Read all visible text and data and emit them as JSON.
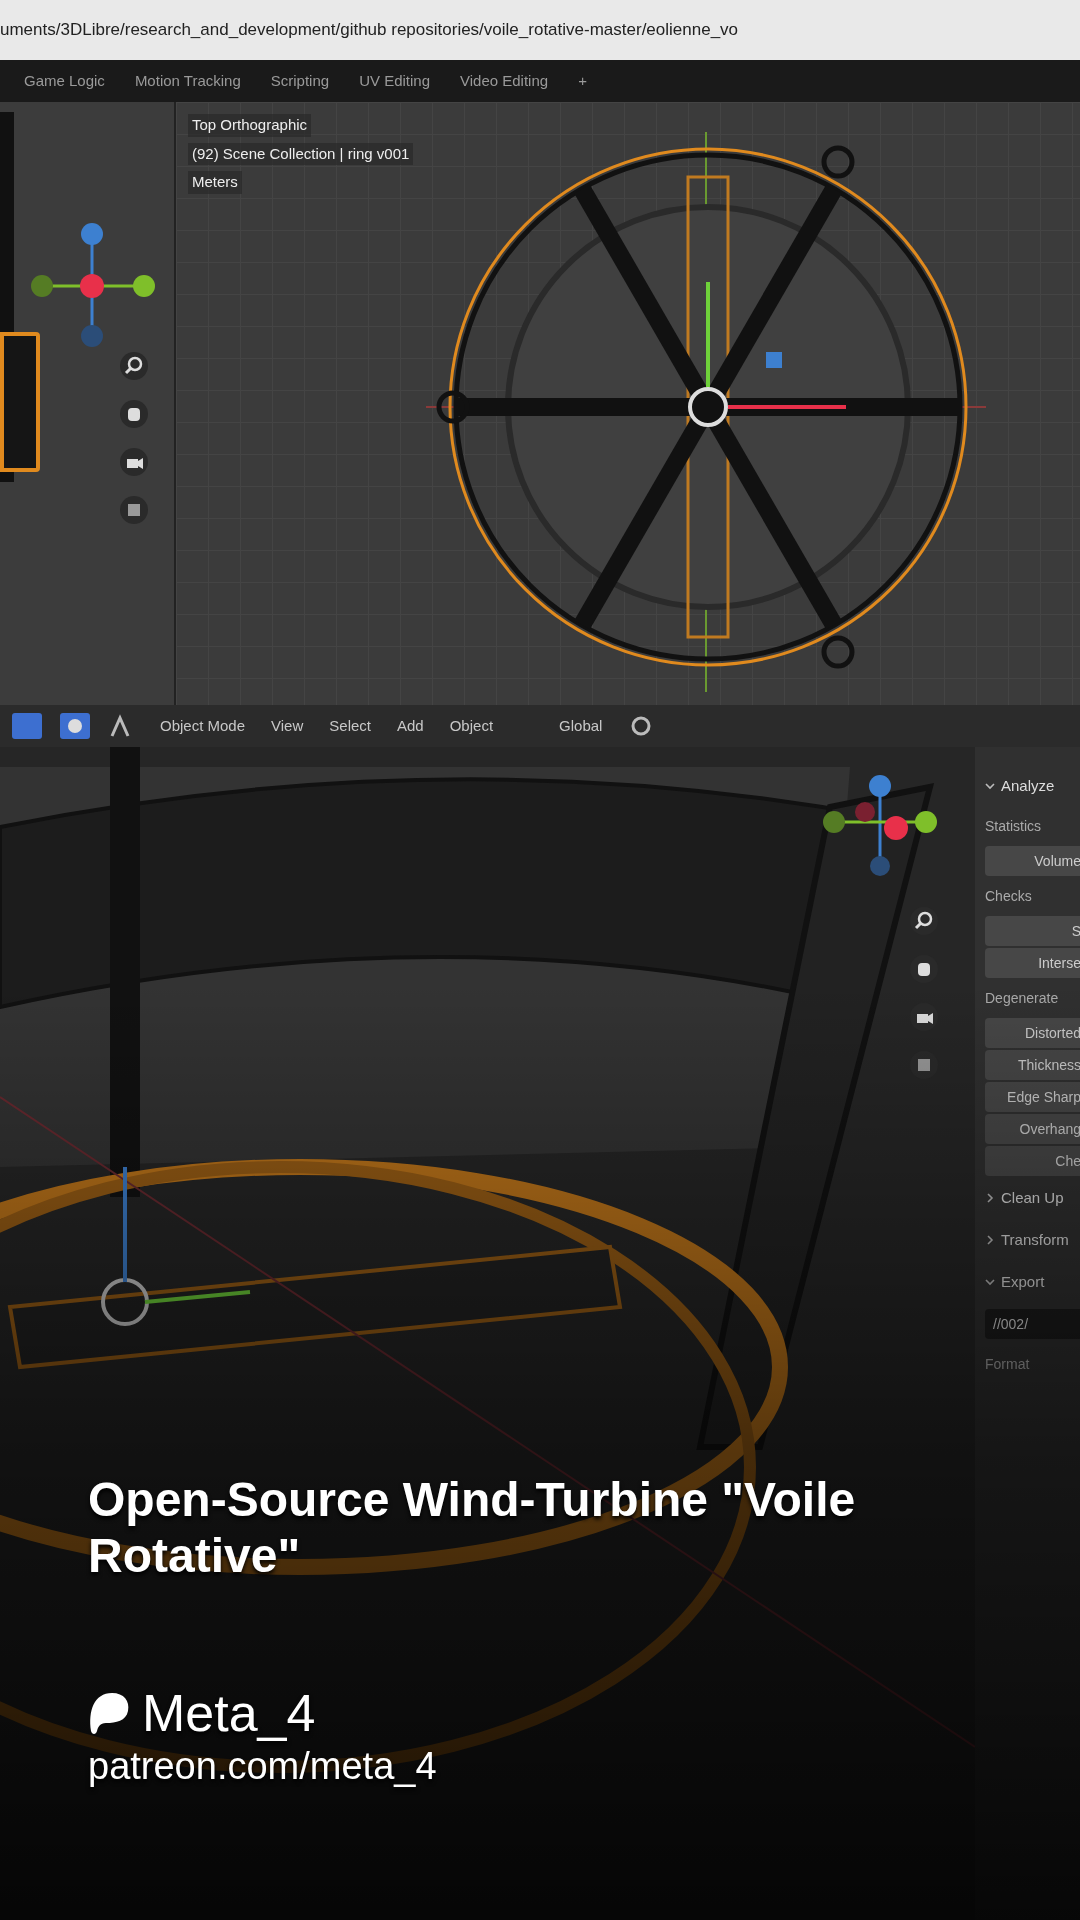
{
  "path_bar": {
    "text": "uments/3DLibre/research_and_development/github repositories/voile_rotative-master/eolienne_vo"
  },
  "workspace_tabs": [
    {
      "label": "Game Logic"
    },
    {
      "label": "Motion Tracking"
    },
    {
      "label": "Scripting"
    },
    {
      "label": "UV Editing"
    },
    {
      "label": "Video Editing"
    },
    {
      "label": "+"
    }
  ],
  "top_viewport": {
    "overlay_lines": [
      "Top Orthographic",
      "(92) Scene Collection | ring v001",
      "Meters"
    ]
  },
  "header": {
    "mode": "Object Mode",
    "menus": [
      "View",
      "Select",
      "Add",
      "Object"
    ],
    "orientation": "Global"
  },
  "side_panel": {
    "items": [
      {
        "kind": "heading",
        "text": "Analyze",
        "expanded": true
      },
      {
        "kind": "label",
        "text": "Statistics"
      },
      {
        "kind": "button",
        "text": "Volume"
      },
      {
        "kind": "label",
        "text": "Checks"
      },
      {
        "kind": "button",
        "text": "S"
      },
      {
        "kind": "button",
        "text": "Interse"
      },
      {
        "kind": "label",
        "text": "Degenerate"
      },
      {
        "kind": "button",
        "text": "Distorted"
      },
      {
        "kind": "button",
        "text": "Thickness"
      },
      {
        "kind": "button",
        "text": "Edge Sharp"
      },
      {
        "kind": "button",
        "text": "Overhang"
      },
      {
        "kind": "button",
        "text": "Che"
      },
      {
        "kind": "heading",
        "text": "Clean Up",
        "expanded": false
      },
      {
        "kind": "heading",
        "text": "Transform",
        "expanded": false
      },
      {
        "kind": "heading",
        "text": "Export",
        "expanded": true
      },
      {
        "kind": "field",
        "text": "//002/"
      },
      {
        "kind": "label",
        "text": "Format"
      }
    ]
  },
  "post": {
    "title": "Open-Source Wind-Turbine \"Voile Rotative\"",
    "creator": "Meta_4",
    "url": "patreon.com/meta_4"
  }
}
